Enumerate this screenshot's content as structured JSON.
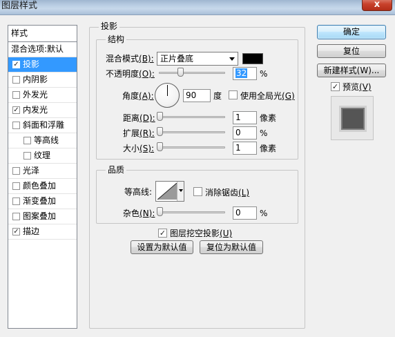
{
  "window": {
    "title": "图层样式",
    "close_label": "x"
  },
  "styles_list": {
    "header": "样式",
    "items": [
      {
        "label": "混合选项:默认",
        "has_checkbox": false,
        "checked": false,
        "selected": false,
        "indent": false
      },
      {
        "label": "投影",
        "has_checkbox": true,
        "checked": true,
        "selected": true,
        "indent": false
      },
      {
        "label": "内阴影",
        "has_checkbox": true,
        "checked": false,
        "selected": false,
        "indent": false
      },
      {
        "label": "外发光",
        "has_checkbox": true,
        "checked": false,
        "selected": false,
        "indent": false
      },
      {
        "label": "内发光",
        "has_checkbox": true,
        "checked": true,
        "selected": false,
        "indent": false
      },
      {
        "label": "斜面和浮雕",
        "has_checkbox": true,
        "checked": false,
        "selected": false,
        "indent": false
      },
      {
        "label": "等高线",
        "has_checkbox": true,
        "checked": false,
        "selected": false,
        "indent": true
      },
      {
        "label": "纹理",
        "has_checkbox": true,
        "checked": false,
        "selected": false,
        "indent": true
      },
      {
        "label": "光泽",
        "has_checkbox": true,
        "checked": false,
        "selected": false,
        "indent": false
      },
      {
        "label": "颜色叠加",
        "has_checkbox": true,
        "checked": false,
        "selected": false,
        "indent": false
      },
      {
        "label": "渐变叠加",
        "has_checkbox": true,
        "checked": false,
        "selected": false,
        "indent": false
      },
      {
        "label": "图案叠加",
        "has_checkbox": true,
        "checked": false,
        "selected": false,
        "indent": false
      },
      {
        "label": "描边",
        "has_checkbox": true,
        "checked": true,
        "selected": false,
        "indent": false
      }
    ]
  },
  "drop_shadow": {
    "group_title": "投影",
    "structure": {
      "group_title": "结构",
      "blend_mode_label": "混合模式",
      "blend_mode_key": "(B):",
      "blend_mode_value": "正片叠底",
      "shadow_color": "#000000",
      "opacity_label": "不透明度",
      "opacity_key": "(O):",
      "opacity_value": "32",
      "opacity_slider_percent": 32,
      "percent_sign": "%",
      "angle_label": "角度",
      "angle_key": "(A):",
      "angle_value": "90",
      "angle_unit": "度",
      "global_light_label": "使用全局光",
      "global_light_key": "(G)",
      "global_light_checked": false,
      "distance_label": "距离",
      "distance_key": "(D):",
      "distance_value": "1",
      "distance_unit": "像素",
      "spread_label": "扩展",
      "spread_key": "(R):",
      "spread_value": "0",
      "spread_unit": "%",
      "size_label": "大小",
      "size_key": "(S):",
      "size_value": "1",
      "size_unit": "像素"
    },
    "quality": {
      "group_title": "品质",
      "contour_label": "等高线:",
      "antialias_label": "消除锯齿",
      "antialias_key": "(L)",
      "antialias_checked": false,
      "noise_label": "杂色",
      "noise_key": "(N):",
      "noise_value": "0",
      "noise_unit": "%"
    },
    "knockout_label": "图层挖空投影",
    "knockout_key": "(U)",
    "knockout_checked": true,
    "make_default_label": "设置为默认值",
    "reset_default_label": "复位为默认值"
  },
  "buttons": {
    "ok": "确定",
    "reset": "复位",
    "new_style": "新建样式(W)..."
  },
  "preview": {
    "label": "预览",
    "key": "(V)",
    "checked": true
  },
  "colors": {
    "selection": "#3399ff",
    "default_button_border": "#3c7fb1",
    "shadow_color": "#000000"
  }
}
